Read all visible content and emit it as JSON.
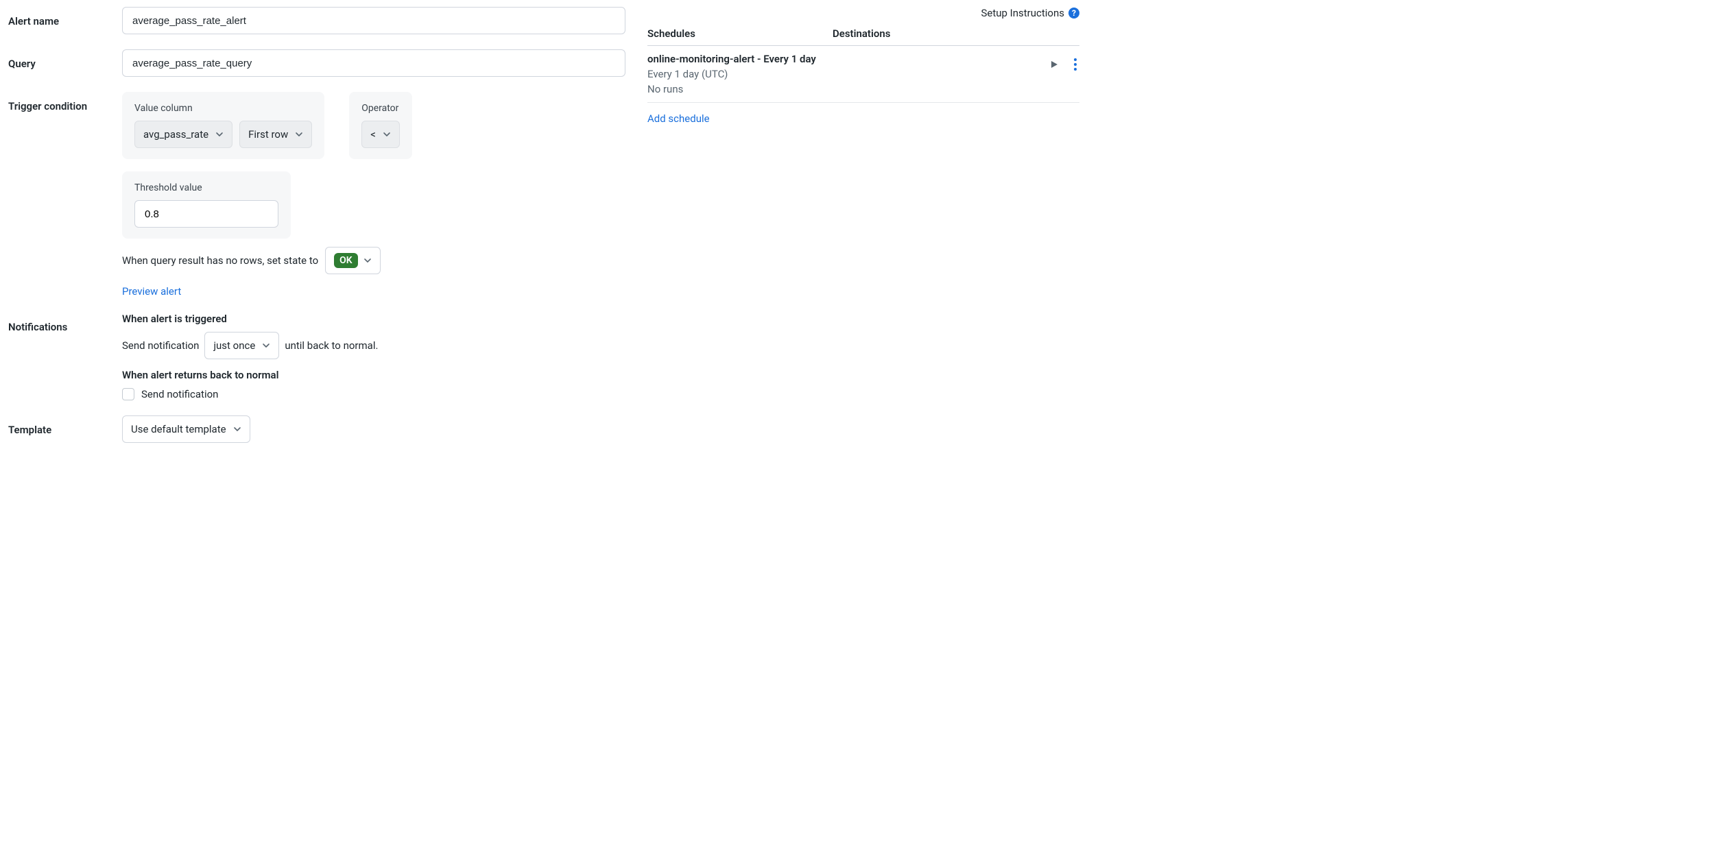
{
  "form": {
    "alert_name": {
      "label": "Alert name",
      "value": "average_pass_rate_alert"
    },
    "query": {
      "label": "Query",
      "value": "average_pass_rate_query"
    },
    "trigger": {
      "label": "Trigger condition",
      "value_column_label": "Value column",
      "value_column": "avg_pass_rate",
      "row_select": "First row",
      "operator_label": "Operator",
      "operator": "<",
      "threshold_label": "Threshold value",
      "threshold_value": "0.8",
      "no_rows_prefix": "When query result has no rows, set state to",
      "no_rows_state": "OK",
      "preview_link": "Preview alert"
    },
    "notifications": {
      "label": "Notifications",
      "triggered_heading": "When alert is triggered",
      "send_prefix": "Send notification",
      "frequency": "just once",
      "send_suffix": "until back to normal.",
      "back_normal_heading": "When alert returns back to normal",
      "back_normal_checkbox_label": "Send notification"
    },
    "template": {
      "label": "Template",
      "value": "Use default template"
    }
  },
  "right": {
    "setup_link": "Setup Instructions",
    "headers": {
      "schedules": "Schedules",
      "destinations": "Destinations"
    },
    "schedule": {
      "title": "online-monitoring-alert - Every 1 day",
      "cadence": "Every 1 day (UTC)",
      "runs": "No runs"
    },
    "add_schedule": "Add schedule"
  }
}
